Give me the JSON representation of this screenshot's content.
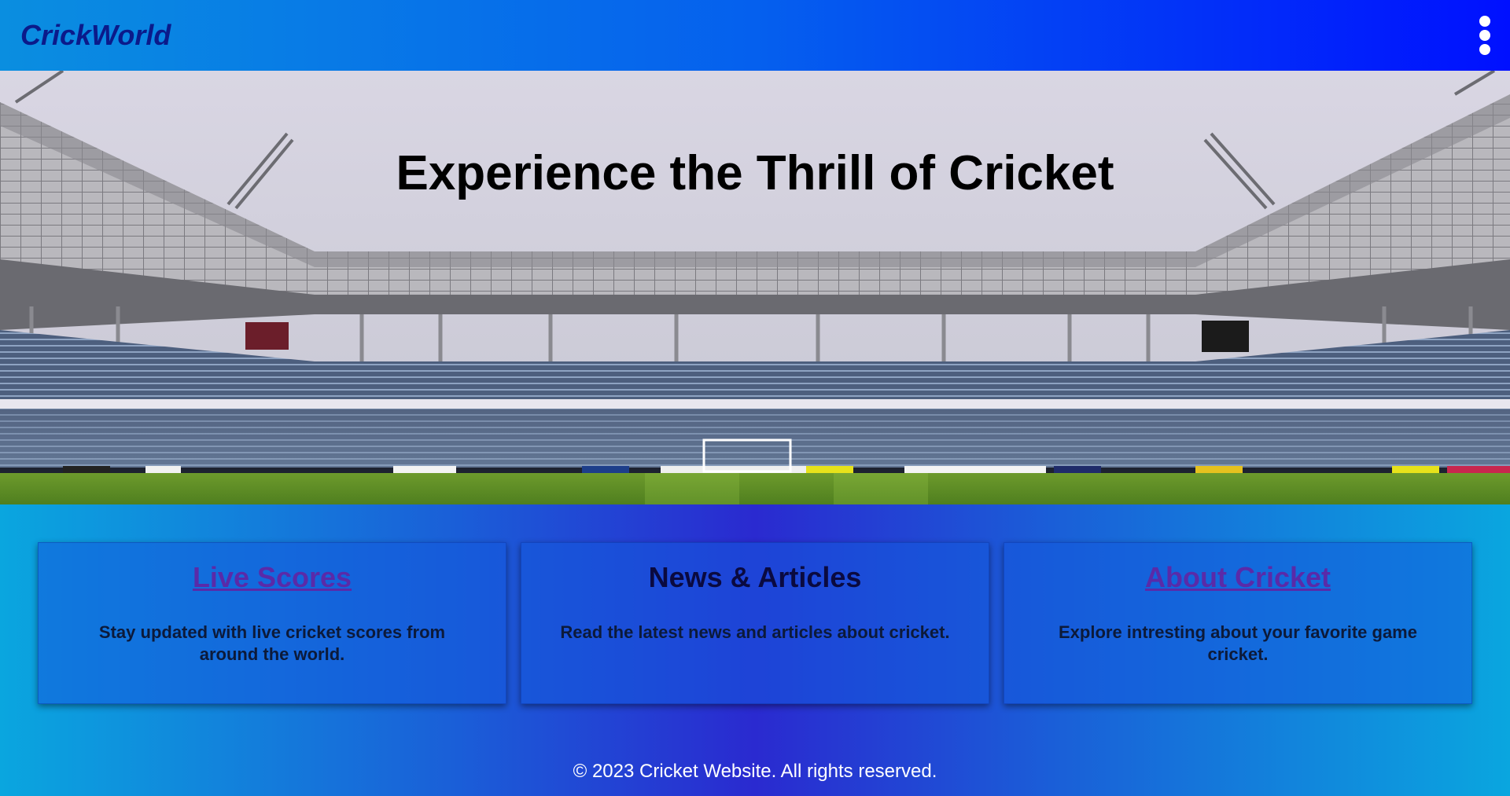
{
  "header": {
    "logo": "CrickWorld",
    "menu_icon": "vertical-dots-icon"
  },
  "hero": {
    "title": "Experience the Thrill of Cricket"
  },
  "cards": [
    {
      "title": "Live Scores",
      "is_link": true,
      "description": "Stay updated with live cricket scores from around the world."
    },
    {
      "title": "News & Articles",
      "is_link": false,
      "description": "Read the latest news and articles about cricket."
    },
    {
      "title": "About Cricket",
      "is_link": true,
      "description": "Explore intresting about your favorite game cricket."
    }
  ],
  "footer": {
    "text": "© 2023 Cricket Website. All rights reserved."
  },
  "colors": {
    "nav_start": "#0a8ee0",
    "nav_end": "#0010ff",
    "logo": "#0b1a8a",
    "link": "#5a2aa8"
  }
}
